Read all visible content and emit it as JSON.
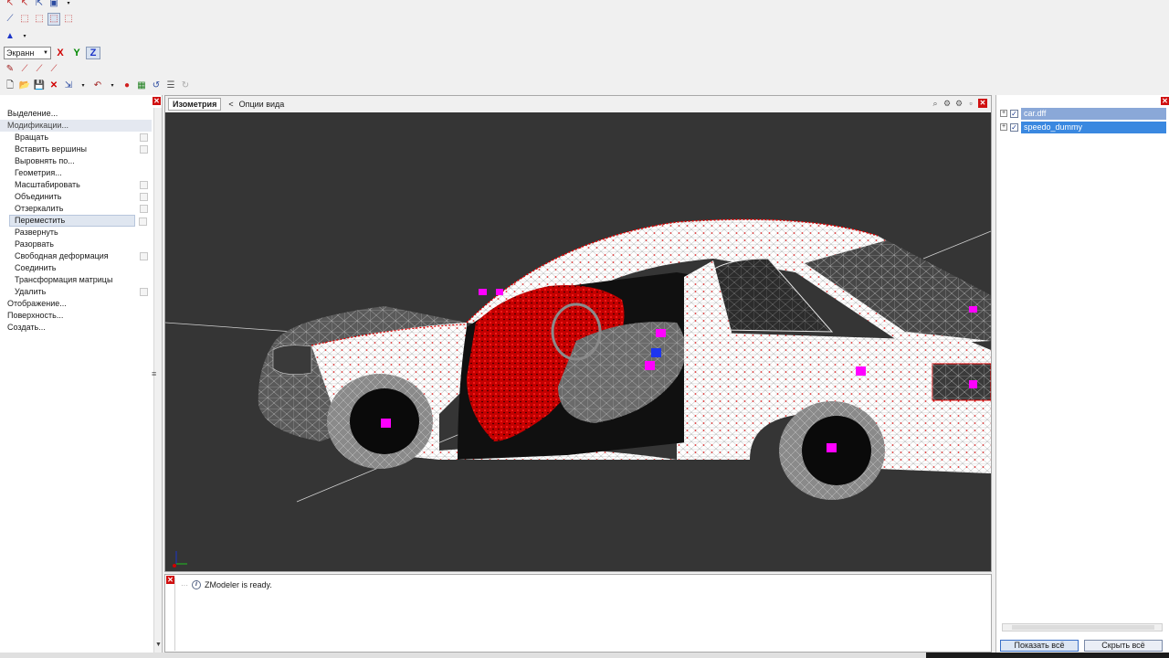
{
  "toolbar": {
    "view_select": "Экранн",
    "axes": {
      "x": "X",
      "y": "Y",
      "z": "Z"
    }
  },
  "left_panel": {
    "items": [
      {
        "label": "Выделение...",
        "level": 0,
        "selected": false,
        "has_option": false
      },
      {
        "label": "Модификации...",
        "level": 0,
        "selected": true,
        "has_option": false
      },
      {
        "label": "Вращать",
        "level": 1,
        "selected": false,
        "has_option": true
      },
      {
        "label": "Вставить вершины",
        "level": 1,
        "selected": false,
        "has_option": true
      },
      {
        "label": "Выровнять по...",
        "level": 1,
        "selected": false,
        "has_option": false
      },
      {
        "label": "Геометрия...",
        "level": 1,
        "selected": false,
        "has_option": false
      },
      {
        "label": "Масштабировать",
        "level": 1,
        "selected": false,
        "has_option": true
      },
      {
        "label": "Объединить",
        "level": 1,
        "selected": false,
        "has_option": true
      },
      {
        "label": "Отзеркалить",
        "level": 1,
        "selected": false,
        "has_option": true
      },
      {
        "label": "Переместить",
        "level": 1,
        "selected": true,
        "has_option": true
      },
      {
        "label": "Развернуть",
        "level": 1,
        "selected": false,
        "has_option": false
      },
      {
        "label": "Разорвать",
        "level": 1,
        "selected": false,
        "has_option": false
      },
      {
        "label": "Свободная деформация",
        "level": 1,
        "selected": false,
        "has_option": true
      },
      {
        "label": "Соединить",
        "level": 1,
        "selected": false,
        "has_option": false
      },
      {
        "label": "Трансформация матрицы",
        "level": 1,
        "selected": false,
        "has_option": false
      },
      {
        "label": "Удалить",
        "level": 1,
        "selected": false,
        "has_option": true
      },
      {
        "label": "Отображение...",
        "level": 0,
        "selected": false,
        "has_option": false
      },
      {
        "label": "Поверхность...",
        "level": 0,
        "selected": false,
        "has_option": false
      },
      {
        "label": "Создать...",
        "level": 0,
        "selected": false,
        "has_option": false
      }
    ]
  },
  "viewport": {
    "tab_label": "Изометрия",
    "nav_arrow": "<",
    "options_label": "Опции вида",
    "background_color": "#353535",
    "wire_color": "#e8e8e8",
    "vertex_color": "#e00000",
    "dummy_color": "#ff00ff"
  },
  "log": {
    "message": "ZModeler is ready."
  },
  "right_panel": {
    "tree": [
      {
        "label": "car.dff",
        "checked": true
      },
      {
        "label": "speedo_dummy",
        "checked": true
      }
    ],
    "show_all_label": "Показать всё",
    "hide_all_label": "Скрыть всё"
  }
}
